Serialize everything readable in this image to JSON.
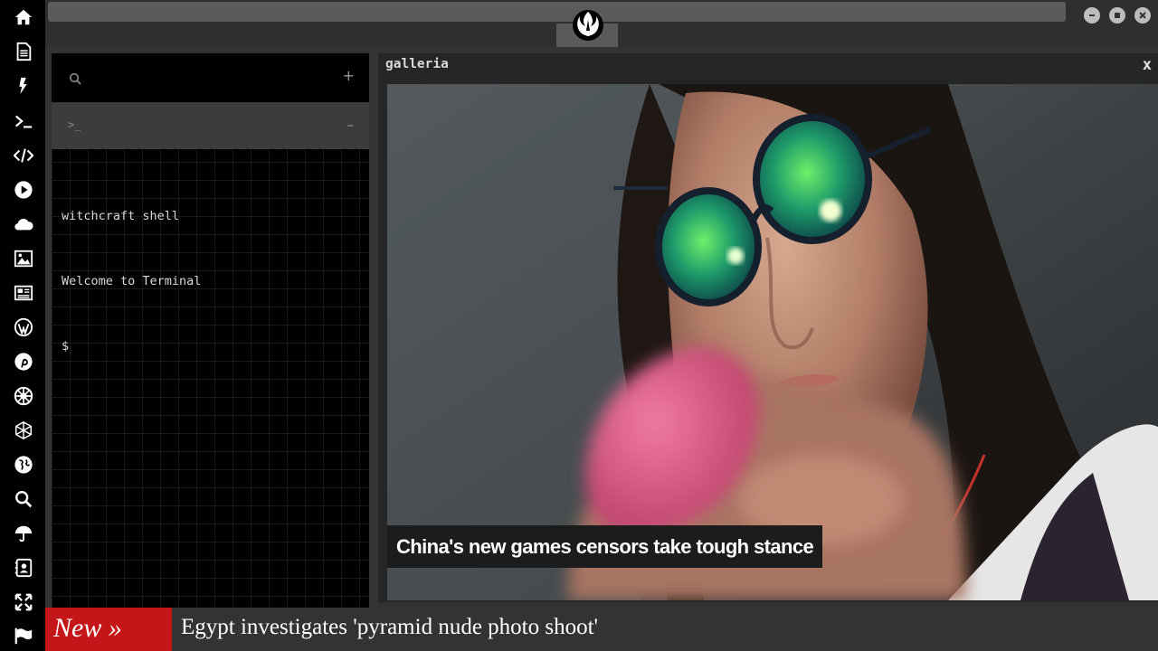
{
  "dock": {
    "icons": [
      "home-icon",
      "document-icon",
      "bolt-icon",
      "terminal-icon",
      "code-icon",
      "play-icon",
      "cloud-icon",
      "image-icon",
      "newspaper-icon",
      "wordpress-icon",
      "pinterest-icon",
      "empire-icon",
      "hexagon-network-icon",
      "globe-icon",
      "search-icon",
      "umbrella-icon",
      "contact-book-icon",
      "expand-icon",
      "flag-icon"
    ]
  },
  "topbar": {
    "logo_icon": "rebel-alliance-icon"
  },
  "terminal": {
    "add_label": "+",
    "collapse_label": "–",
    "prompt_tab_label": ">_",
    "lines": [
      "witchcraft shell",
      "Welcome to Terminal",
      "$"
    ]
  },
  "gallery": {
    "title": "galleria",
    "close_label": "x",
    "caption": "China's new games censors take tough stance"
  },
  "ticker": {
    "label": "New »",
    "headline": "Egypt investigates 'pyramid nude photo shoot'",
    "accent_color": "#c41518"
  }
}
